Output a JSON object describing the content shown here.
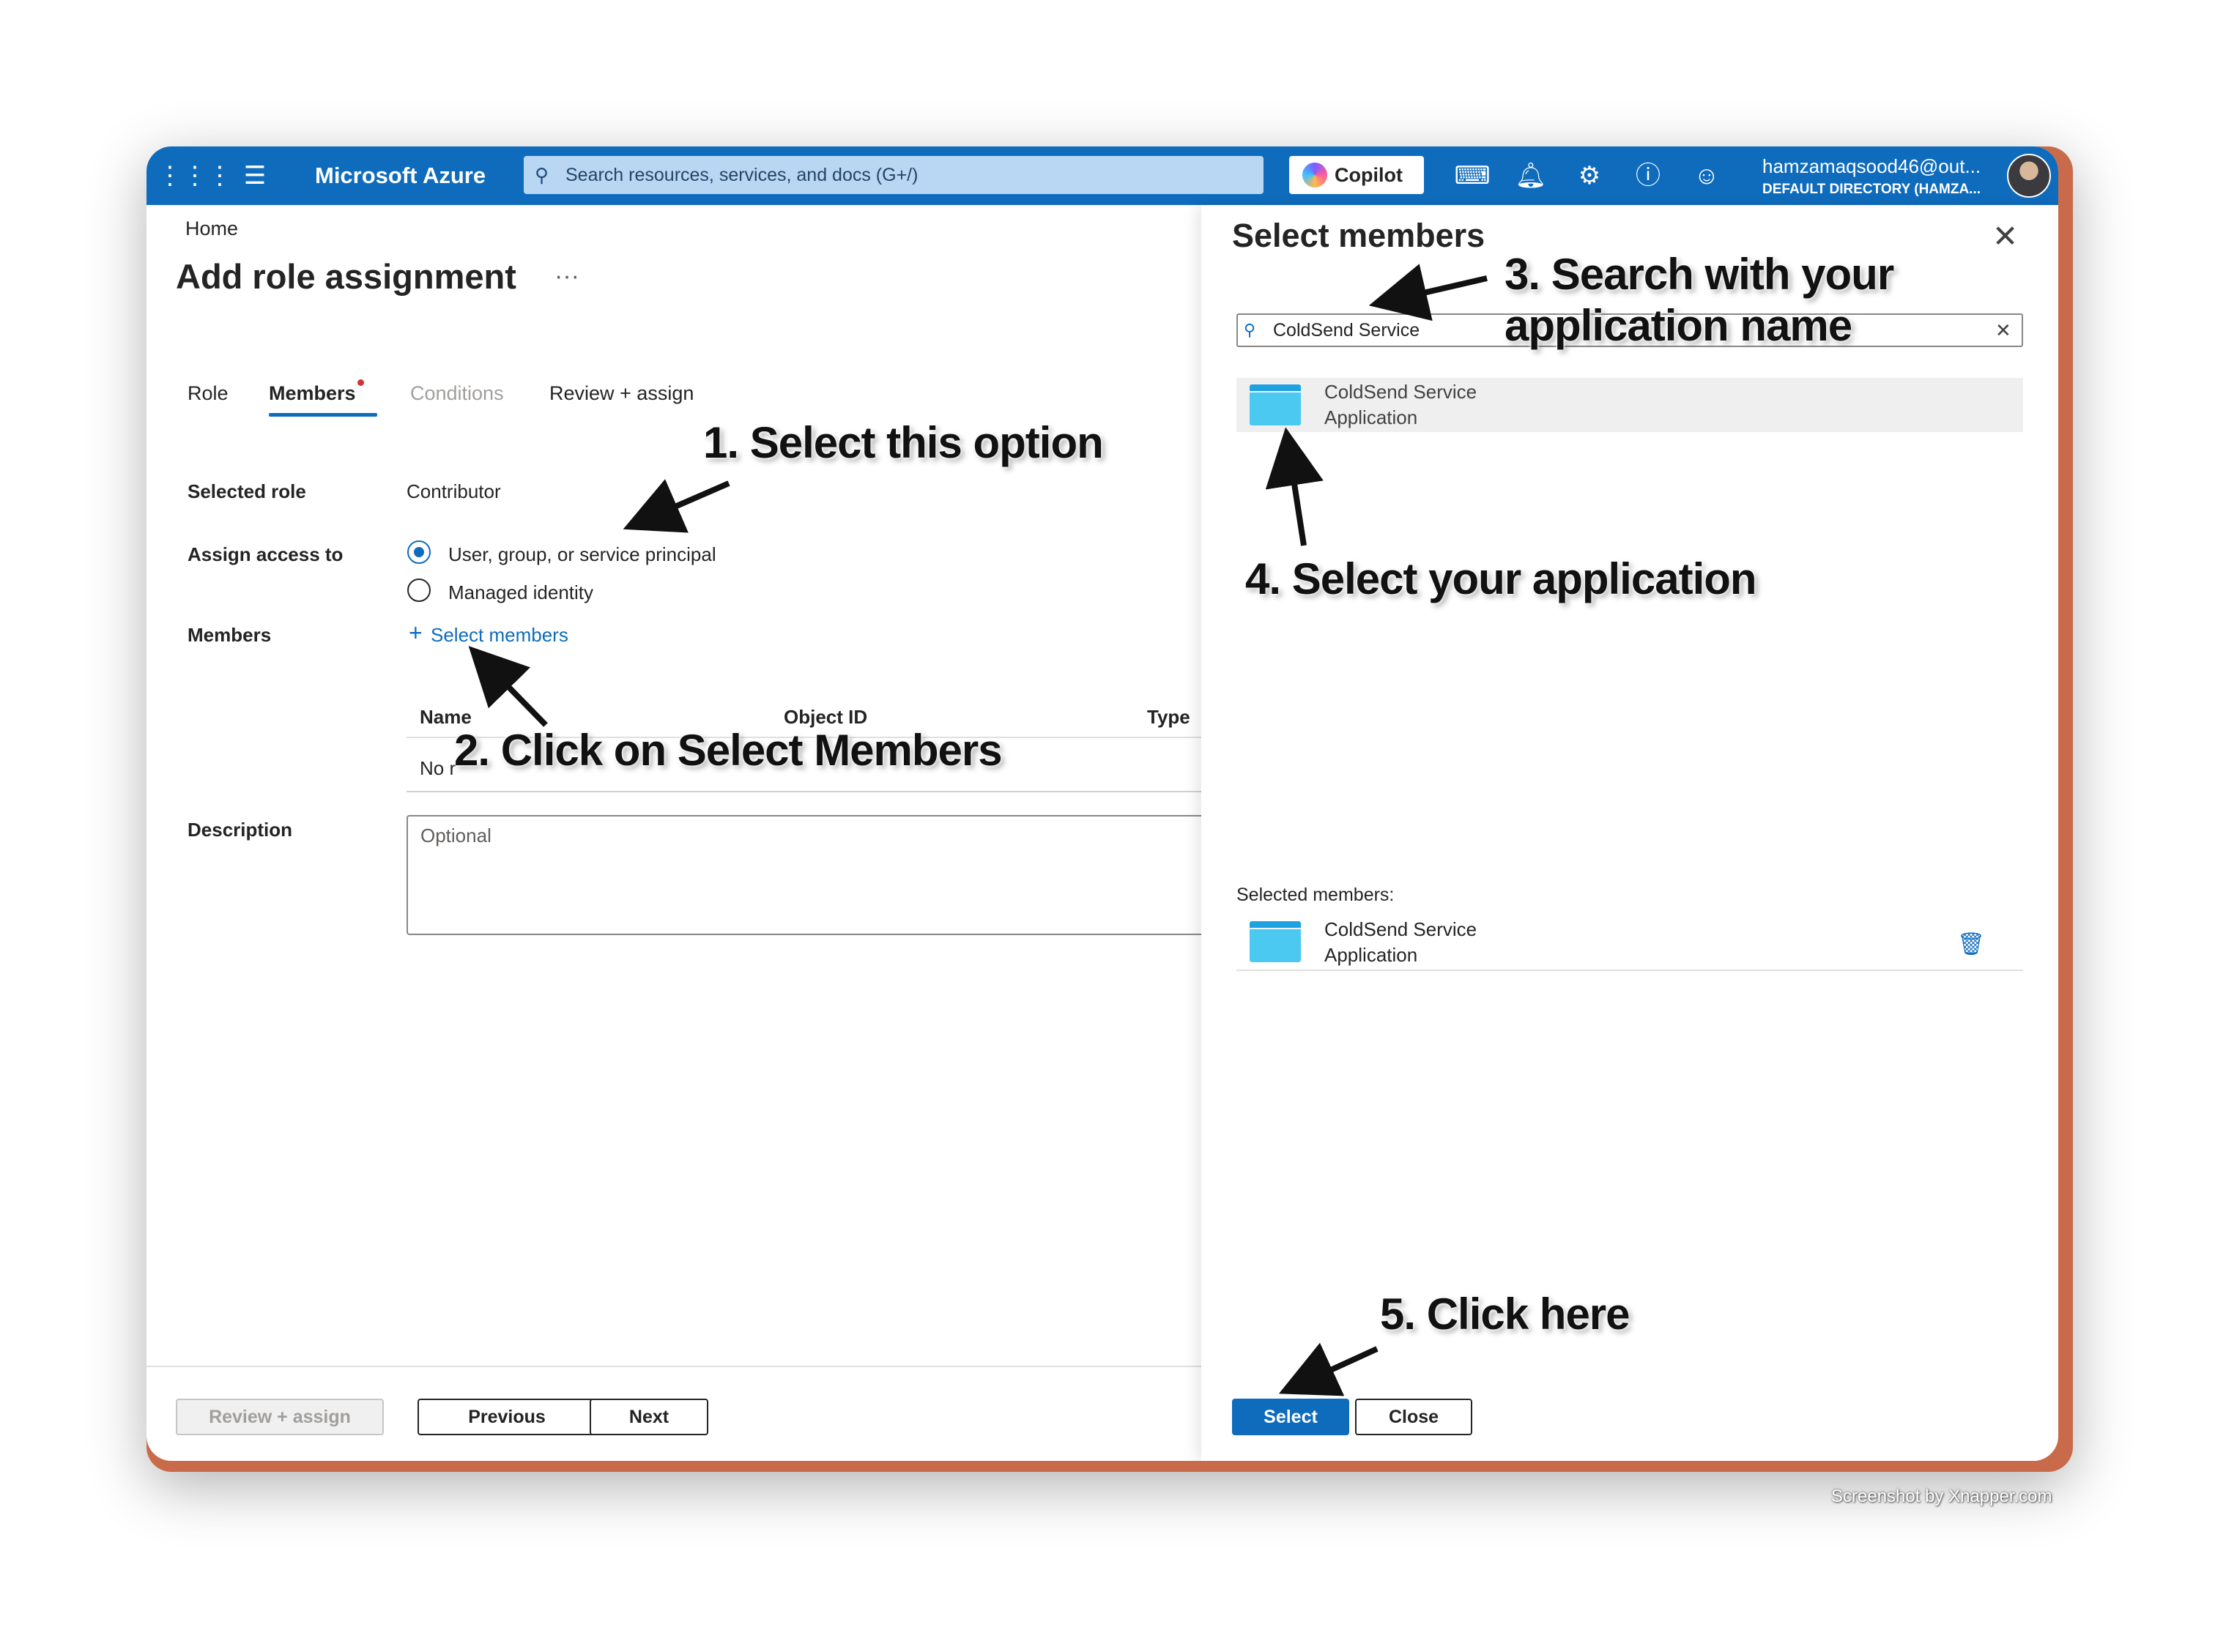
{
  "topbar": {
    "brand": "Microsoft Azure",
    "search_placeholder": "Search resources, services, and docs (G+/)",
    "copilot_label": "Copilot",
    "user_name": "hamzamaqsood46@out...",
    "user_directory": "DEFAULT DIRECTORY (HAMZA...",
    "icons": [
      "waffle-icon",
      "hamburger-icon",
      "cloud-shell-icon",
      "bell-icon",
      "settings-icon",
      "help-icon",
      "feedback-icon"
    ]
  },
  "page": {
    "breadcrumb": "Home",
    "title": "Add role assignment",
    "more": "···",
    "tabs": [
      "Role",
      "Members",
      "Conditions",
      "Review + assign"
    ],
    "selected_role_label": "Selected role",
    "selected_role_value": "Contributor",
    "assign_access_label": "Assign access to",
    "radio_options": [
      "User, group, or service principal",
      "Managed identity"
    ],
    "members_label": "Members",
    "select_members_link": "Select members",
    "table_headers": [
      "Name",
      "Object ID",
      "Type"
    ],
    "table_empty_visible": "No r",
    "description_label": "Description",
    "description_placeholder": "Optional"
  },
  "footer": {
    "review_assign": "Review + assign",
    "previous": "Previous",
    "next": "Next"
  },
  "panel": {
    "title": "Select members",
    "search_value": "ColdSend Service",
    "result": {
      "name": "ColdSend Service",
      "type": "Application"
    },
    "selected_members_label": "Selected members:",
    "selected": {
      "name": "ColdSend Service",
      "type": "Application"
    },
    "select_button": "Select",
    "close_button": "Close"
  },
  "annotations": {
    "step1": "1. Select this option",
    "step2": "2. Click on Select Members",
    "step3_line1": "3. Search with your",
    "step3_line2": "application name",
    "step4": "4. Select your application",
    "step5": "5. Click here"
  },
  "credit": "Screenshot by Xnapper.com",
  "colors": {
    "accent": "#0f6cbd",
    "frame": "#c96a4a"
  }
}
